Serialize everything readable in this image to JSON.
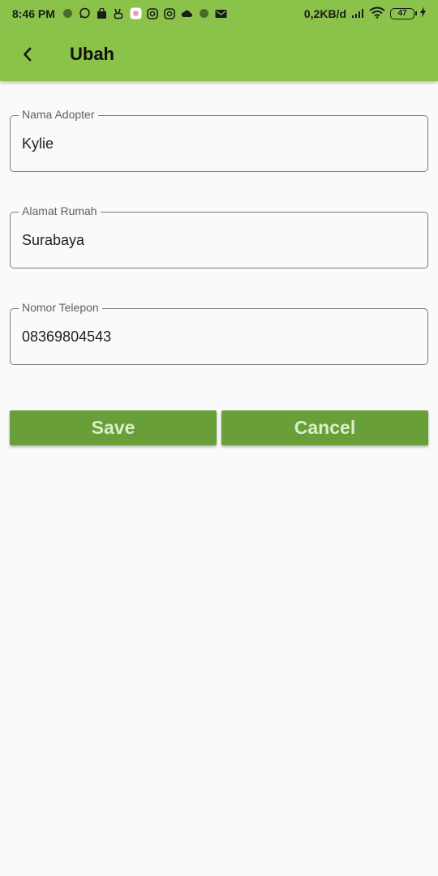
{
  "status_bar": {
    "time": "8:46 PM",
    "net_speed": "0,2KB/d",
    "battery": "47",
    "icons": [
      "circle-icon",
      "whatsapp-icon",
      "shopping-bag-icon",
      "peace-hand-icon",
      "app-badge-icon",
      "instagram-icon",
      "instagram-icon",
      "cloud-icon",
      "circle-icon",
      "email-icon"
    ]
  },
  "appbar": {
    "title": "Ubah",
    "color": "#8bc34a"
  },
  "form": {
    "name": {
      "label": "Nama Adopter",
      "value": "Kylie"
    },
    "address": {
      "label": "Alamat Rumah",
      "value": "Surabaya"
    },
    "phone": {
      "label": "Nomor Telepon",
      "value": "08369804543"
    }
  },
  "buttons": {
    "save_label": "Save",
    "cancel_label": "Cancel",
    "color": "#689f38"
  }
}
